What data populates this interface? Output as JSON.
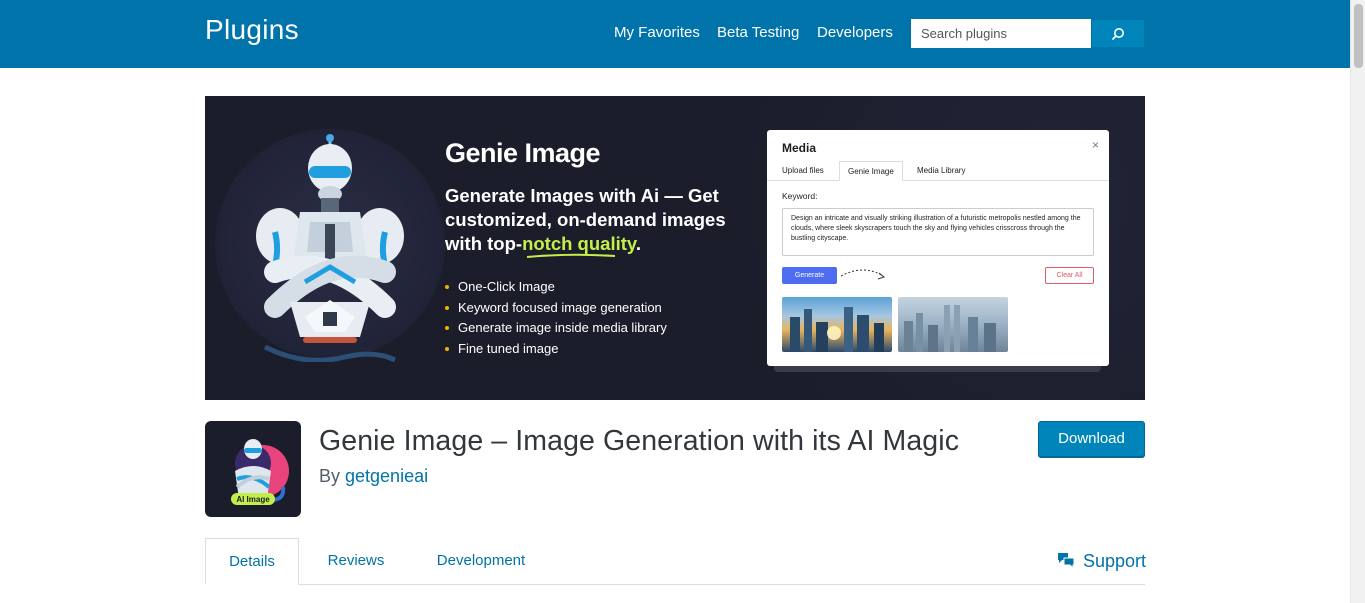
{
  "header": {
    "title": "Plugins",
    "nav": [
      "My Favorites",
      "Beta Testing",
      "Developers"
    ],
    "search_placeholder": "Search plugins"
  },
  "banner": {
    "title": "Genie Image",
    "subtitle_pre": "Generate Images with Ai — Get customized, on-demand images with top-",
    "subtitle_highlight": "notch quality",
    "subtitle_post": ".",
    "features": [
      "One-Click Image",
      "Keyword focused image generation",
      "Generate image inside media library",
      "Fine tuned image"
    ],
    "modal": {
      "title": "Media",
      "close": "×",
      "tabs": [
        "Upload files",
        "Genie Image",
        "Media Library"
      ],
      "keyword_label": "Keyword:",
      "keyword_text": "Design an intricate and visually striking illustration of a futuristic metropolis nestled among the clouds, where sleek skyscrapers touch the sky and flying vehicles crisscross through the bustling cityscape.",
      "generate_label": "Generate",
      "clear_label": "Clear All"
    },
    "highlight_color": "#c4ef4a"
  },
  "plugin": {
    "icon_badge": "AI Image",
    "title": "Genie Image – Image Generation with its AI Magic",
    "by_prefix": "By ",
    "author": "getgenieai",
    "download_label": "Download"
  },
  "tabs": [
    "Details",
    "Reviews",
    "Development"
  ],
  "support_label": "Support",
  "colors": {
    "header_bg": "#0073aa",
    "link": "#0073aa",
    "button": "#0085ba"
  }
}
